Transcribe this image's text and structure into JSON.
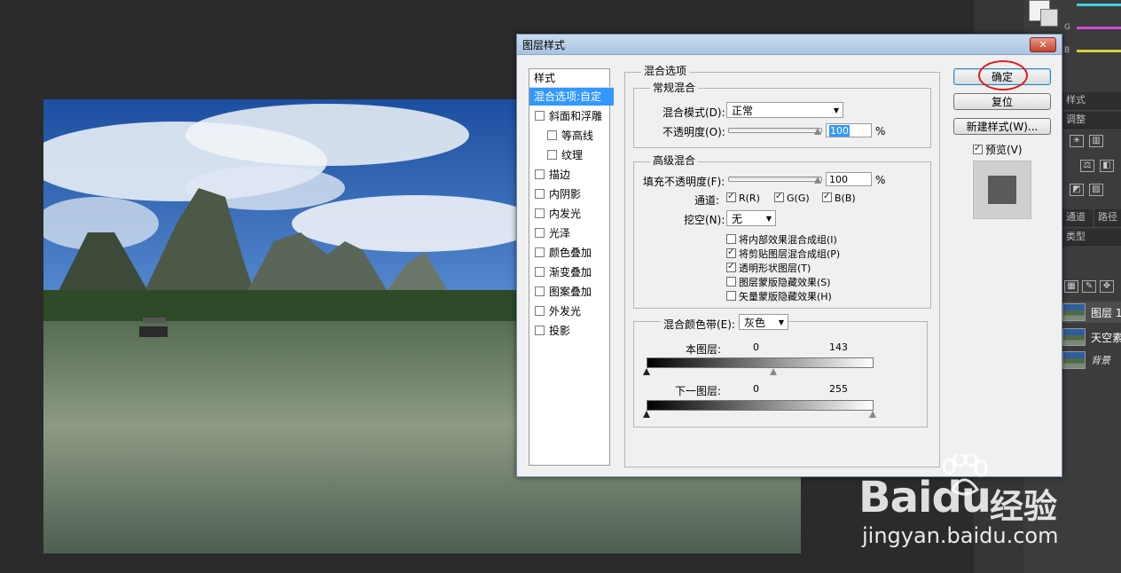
{
  "dialog": {
    "title": "图层样式",
    "close_label": "✕",
    "style_list": {
      "header": "样式",
      "selected": "混合选项:自定",
      "items": [
        {
          "label": "斜面和浮雕",
          "sub": false
        },
        {
          "label": "等高线",
          "sub": true
        },
        {
          "label": "纹理",
          "sub": true
        },
        {
          "label": "描边",
          "sub": false
        },
        {
          "label": "内阴影",
          "sub": false
        },
        {
          "label": "内发光",
          "sub": false
        },
        {
          "label": "光泽",
          "sub": false
        },
        {
          "label": "颜色叠加",
          "sub": false
        },
        {
          "label": "渐变叠加",
          "sub": false
        },
        {
          "label": "图案叠加",
          "sub": false
        },
        {
          "label": "外发光",
          "sub": false
        },
        {
          "label": "投影",
          "sub": false
        }
      ]
    },
    "blend_options": {
      "legend": "混合选项",
      "general": {
        "legend": "常规混合",
        "mode_label": "混合模式(D):",
        "mode_value": "正常",
        "opacity_label": "不透明度(O):",
        "opacity_value": "100",
        "unit": "%"
      },
      "advanced": {
        "legend": "高级混合",
        "fill_label": "填充不透明度(F):",
        "fill_value": "100",
        "unit": "%",
        "channels_label": "通道:",
        "channels": [
          {
            "label": "R(R)",
            "checked": true
          },
          {
            "label": "G(G)",
            "checked": true
          },
          {
            "label": "B(B)",
            "checked": true
          }
        ],
        "knockout_label": "挖空(N):",
        "knockout_value": "无",
        "options": [
          {
            "label": "将内部效果混合成组(I)",
            "checked": false
          },
          {
            "label": "将剪贴图层混合成组(P)",
            "checked": true
          },
          {
            "label": "透明形状图层(T)",
            "checked": true
          },
          {
            "label": "图层蒙版隐藏效果(S)",
            "checked": false
          },
          {
            "label": "矢量蒙版隐藏效果(H)",
            "checked": false
          }
        ]
      },
      "blend_if": {
        "label": "混合颜色带(E):",
        "value": "灰色",
        "this_layer_label": "本图层:",
        "this_layer_low": "0",
        "this_layer_high": "143",
        "under_layer_label": "下一图层:",
        "under_layer_low": "0",
        "under_layer_high": "255"
      }
    },
    "buttons": {
      "ok": "确定",
      "reset": "复位",
      "new_style": "新建样式(W)...",
      "preview": "预览(V)",
      "preview_checked": true
    }
  },
  "right_panel": {
    "channel_labels": [
      "G",
      "B"
    ],
    "tab_styles": "样式",
    "tab_adjust": "调整",
    "tab_channels": "通道",
    "tab_paths": "路径",
    "filter_label": "类型",
    "layers": [
      {
        "name": "图层 1"
      },
      {
        "name": "天空素材"
      },
      {
        "name": "背景"
      }
    ]
  },
  "watermark": {
    "brand": "Bai",
    "brand2": "du",
    "brand_cn": "经验",
    "url": "jingyan.baidu.com"
  },
  "colors": {
    "accent": "#3399ff",
    "annotation_circle": "#e21b1b"
  }
}
